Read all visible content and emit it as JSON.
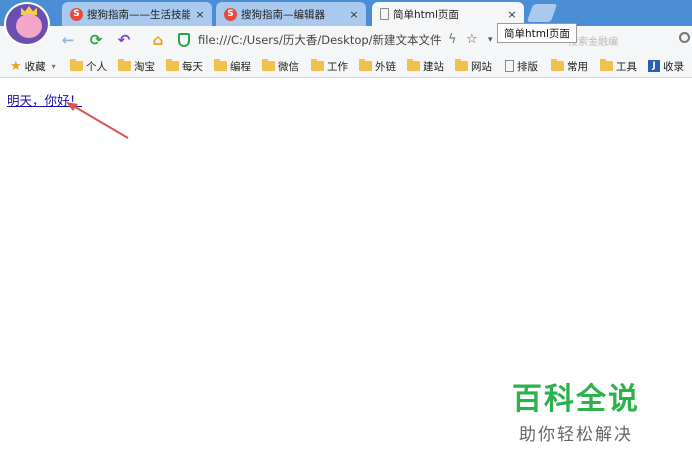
{
  "tabs": [
    {
      "title": "搜狗指南——生活技能百",
      "close": "×",
      "icon": "sogou-icon"
    },
    {
      "title": "搜狗指南—编辑器",
      "close": "×",
      "icon": "sogou-icon"
    },
    {
      "title": "简单html页面",
      "close": "×",
      "icon": "page-icon"
    }
  ],
  "tooltip": "简单html页面",
  "toolbar": {
    "back": "←",
    "refresh": "⟳",
    "undo": "↶",
    "home": "⌂",
    "address": "file:///C:/Users/历大香/Desktop/新建文本文件",
    "search_placeholder": "搜索金融编"
  },
  "bookmarks": [
    {
      "label": "收藏",
      "icon": "star-icon"
    },
    {
      "label": "个人",
      "icon": "folder-icon"
    },
    {
      "label": "淘宝",
      "icon": "folder-icon"
    },
    {
      "label": "每天",
      "icon": "folder-icon"
    },
    {
      "label": "编程",
      "icon": "folder-icon"
    },
    {
      "label": "微信",
      "icon": "folder-icon"
    },
    {
      "label": "工作",
      "icon": "folder-icon"
    },
    {
      "label": "外链",
      "icon": "folder-icon"
    },
    {
      "label": "建站",
      "icon": "folder-icon"
    },
    {
      "label": "网站",
      "icon": "folder-icon"
    },
    {
      "label": "排版",
      "icon": "page-icon"
    },
    {
      "label": "常用",
      "icon": "folder-icon"
    },
    {
      "label": "工具",
      "icon": "folder-icon"
    },
    {
      "label": "收录",
      "icon": "j-icon"
    }
  ],
  "content": {
    "link_text": "明天，你好！"
  },
  "watermark": {
    "main": "百科全说",
    "sub": "助你轻松解决"
  },
  "colors": {
    "tabstrip": "#4a8fd6",
    "link": "#1a0dab",
    "arrow": "#d9534f",
    "watermark": "#2bb24c"
  }
}
